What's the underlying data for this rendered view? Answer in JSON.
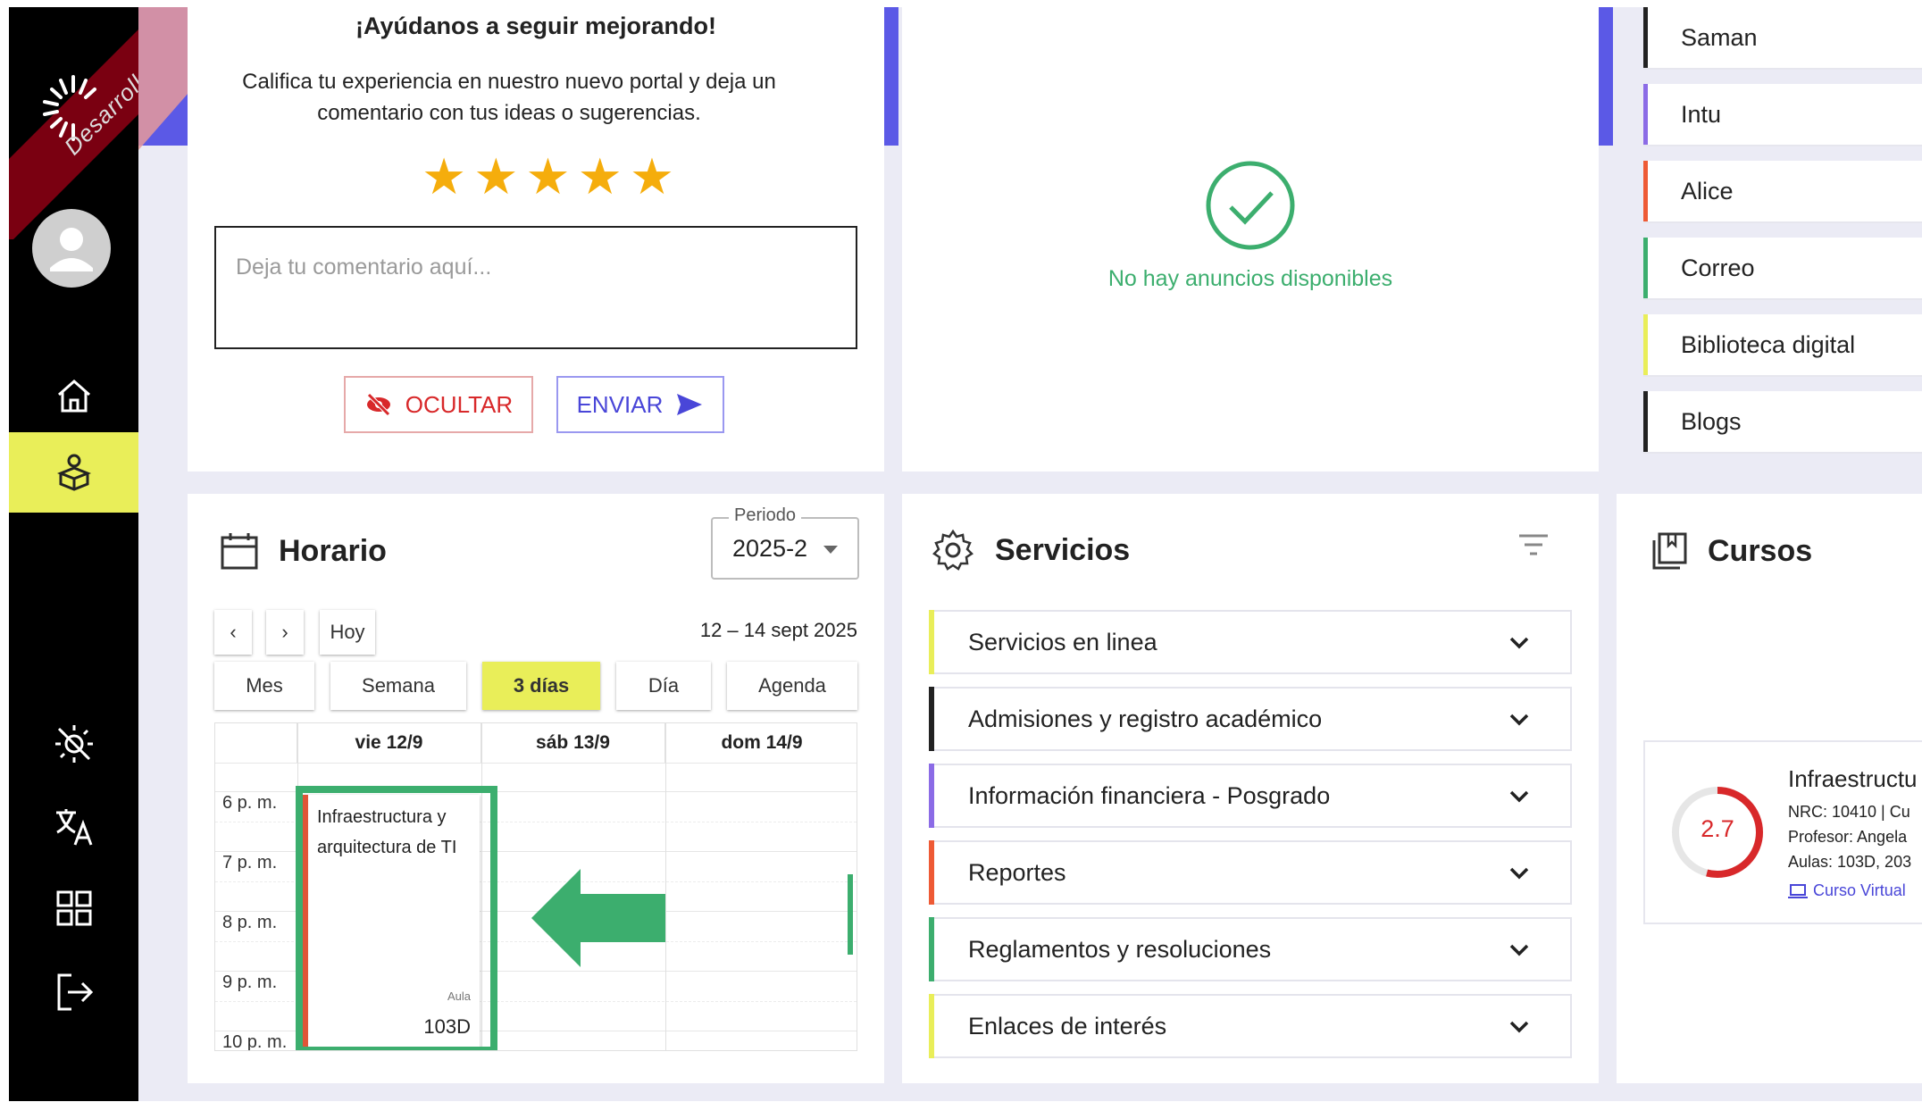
{
  "sidebar": {
    "watermark": "Desarrollo",
    "active_index": 1,
    "colors": {
      "background": "#000000",
      "active": "#e9ee59",
      "ribbon": "#7a0011"
    }
  },
  "feedback": {
    "title": "¡Ayúdanos a seguir mejorando!",
    "text": "Califica tu experiencia en nuestro nuevo portal y deja un comentario con tus ideas o sugerencias.",
    "stars": [
      "★",
      "★",
      "★",
      "★",
      "★"
    ],
    "comment_placeholder": "Deja tu comentario aquí...",
    "hide_label": "OCULTAR",
    "send_label": "ENVIAR"
  },
  "announcements": {
    "empty_text": "No hay anuncios disponibles"
  },
  "links": [
    {
      "label": "Saman",
      "color": "#222222"
    },
    {
      "label": "Intu",
      "color": "#8b6be6"
    },
    {
      "label": "Alice",
      "color": "#ee5a35"
    },
    {
      "label": "Correo",
      "color": "#3cae6e"
    },
    {
      "label": "Biblioteca digital",
      "color": "#e9ee59"
    },
    {
      "label": "Blogs",
      "color": "#222222"
    }
  ],
  "horario": {
    "title": "Horario",
    "periodo_label": "Periodo",
    "periodo_value": "2025-2",
    "prev": "‹",
    "next": "›",
    "today": "Hoy",
    "date_range": "12 – 14 sept 2025",
    "views": [
      "Mes",
      "Semana",
      "3 días",
      "Día",
      "Agenda"
    ],
    "active_view": "3 días",
    "days": [
      "vie 12/9",
      "sáb 13/9",
      "dom 14/9"
    ],
    "times": [
      "6 p. m.",
      "7 p. m.",
      "8 p. m.",
      "9 p. m.",
      "10 p. m."
    ],
    "event": {
      "title": "Infraestructura y arquitectura de TI",
      "aula_label": "Aula",
      "room": "103D",
      "color": "#e15537"
    }
  },
  "servicios": {
    "title": "Servicios",
    "items": [
      {
        "label": "Servicios en linea",
        "color": "#e9ee59"
      },
      {
        "label": "Admisiones y registro académico",
        "color": "#222222"
      },
      {
        "label": "Información financiera - Posgrado",
        "color": "#8b6be6"
      },
      {
        "label": "Reportes",
        "color": "#ee5a35"
      },
      {
        "label": "Reglamentos y resoluciones",
        "color": "#3cae6e"
      },
      {
        "label": "Enlaces de interés",
        "color": "#e9ee59"
      }
    ]
  },
  "cursos": {
    "title": "Cursos",
    "course": {
      "name": "Infraestructu",
      "nrc": "NRC: 10410 | Cu",
      "profesor": "Profesor: Angela",
      "aulas": "Aulas: 103D, 203",
      "link": "Curso Virtual",
      "grade": "2.7",
      "grade_fraction": 0.54,
      "grade_color": "#d8282a"
    }
  },
  "colors": {
    "accent": "#5b59e6",
    "success": "#3cae6e",
    "danger": "#d8282a",
    "star": "#f5ad0c"
  }
}
